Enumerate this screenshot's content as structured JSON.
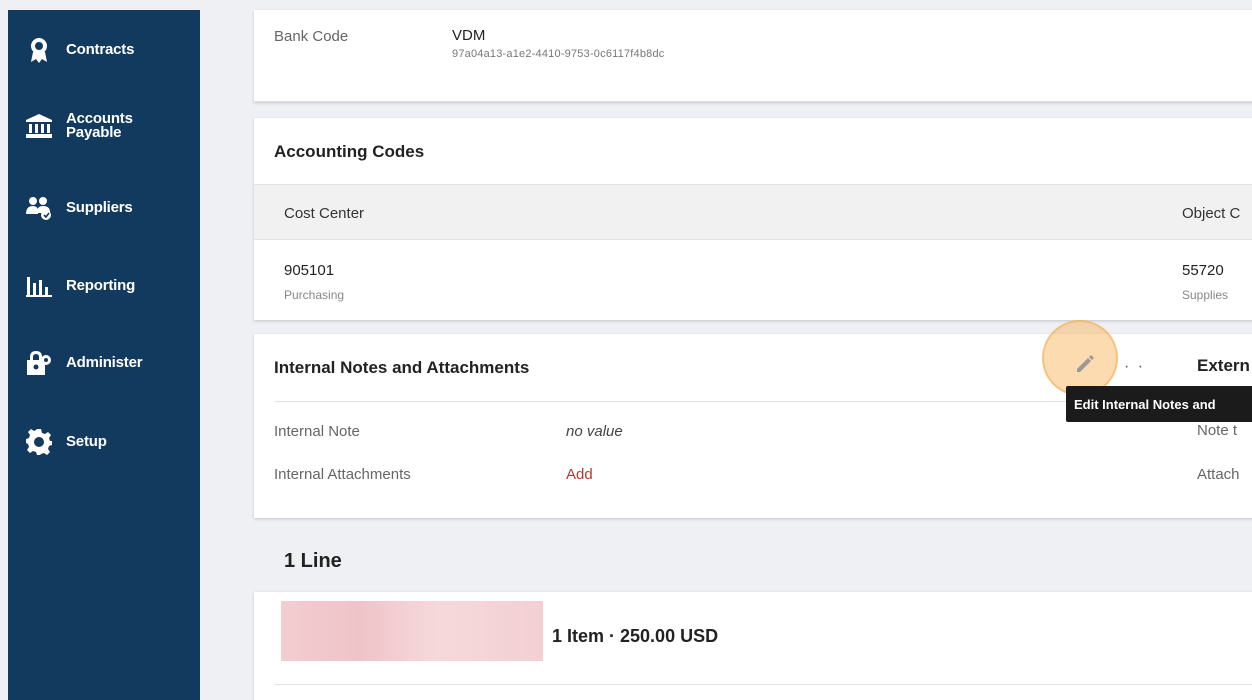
{
  "sidebar": {
    "items": [
      {
        "id": "contracts",
        "label": "Contracts",
        "icon": "award-icon"
      },
      {
        "id": "accounts-payable",
        "label": "Accounts Payable",
        "icon": "bank-icon"
      },
      {
        "id": "suppliers",
        "label": "Suppliers",
        "icon": "users-icon"
      },
      {
        "id": "reporting",
        "label": "Reporting",
        "icon": "bar-chart-icon"
      },
      {
        "id": "administer",
        "label": "Administer",
        "icon": "lock-gear-icon"
      },
      {
        "id": "setup",
        "label": "Setup",
        "icon": "gear-icon"
      }
    ]
  },
  "bank": {
    "label": "Bank Code",
    "value": "VDM",
    "id": "97a04a13-a1e2-4410-9753-0c6117f4b8dc"
  },
  "accounting": {
    "title": "Accounting Codes",
    "columns": [
      "Cost Center",
      "Object C"
    ],
    "rows": [
      {
        "value": "905101",
        "sub": "Purchasing"
      },
      {
        "value": "55720",
        "sub": "Supplies"
      }
    ]
  },
  "notes": {
    "title": "Internal Notes and Attachments",
    "dots": "· ·",
    "external_title": "Extern",
    "tooltip": "Edit Internal Notes and",
    "fields": [
      {
        "label": "Internal Note",
        "value": "no value",
        "right_label": "Note t"
      },
      {
        "label": "Internal Attachments",
        "value": "Add",
        "right_label": "Attach"
      }
    ]
  },
  "lines": {
    "title": "1 Line",
    "summary": "1 Item · 250.00 USD"
  },
  "colors": {
    "sidebar_bg": "#12395e",
    "link": "#b33a2e",
    "highlight": "#f7be6e"
  }
}
